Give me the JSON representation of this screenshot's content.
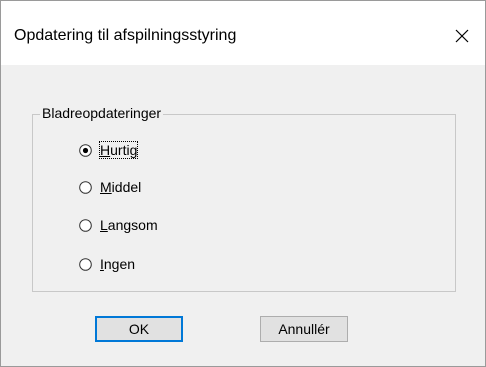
{
  "dialog": {
    "title": "Opdatering til afspilningsstyring",
    "close_glyph": "close-icon"
  },
  "group": {
    "label": "Bladreopdateringer",
    "options": [
      {
        "label": "Hurtig",
        "mnemonic": "H",
        "rest": "urtig",
        "selected": true
      },
      {
        "label": "Middel",
        "mnemonic": "M",
        "rest": "iddel",
        "selected": false
      },
      {
        "label": "Langsom",
        "mnemonic": "L",
        "rest": "angsom",
        "selected": false
      },
      {
        "label": "Ingen",
        "mnemonic": "I",
        "rest": "ngen",
        "selected": false
      }
    ]
  },
  "buttons": {
    "ok_label": "OK",
    "cancel_label": "Annullér"
  },
  "colors": {
    "accent": "#0078d7",
    "dialog_bg": "#f0f0f0",
    "title_bg": "#ffffff"
  }
}
